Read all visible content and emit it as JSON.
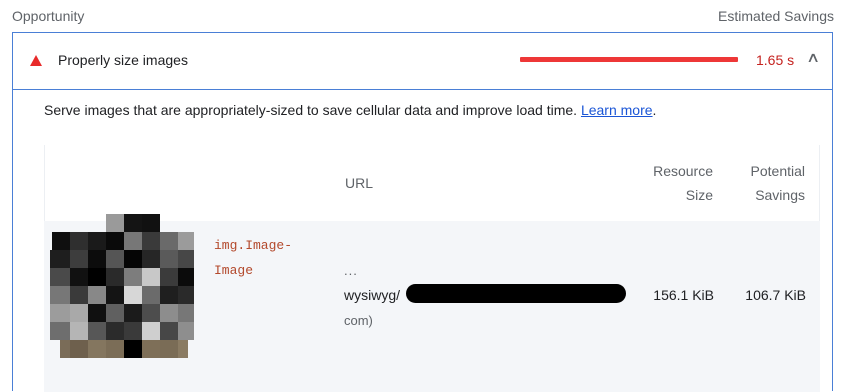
{
  "header": {
    "left": "Opportunity",
    "right": "Estimated Savings"
  },
  "audit": {
    "title": "Properly size images",
    "savings": "1.65 s",
    "description": "Serve images that are appropriately-sized to save cellular data and improve load time.",
    "learn_more": "Learn more",
    "colors": {
      "warning": "#e82a2a",
      "bar": "#ee3737",
      "link": "#1a55d6",
      "accent": "#4a7fd6"
    }
  },
  "table": {
    "columns": {
      "url": "URL",
      "resource_size_l1": "Resource",
      "resource_size_l2": "Size",
      "potential_savings_l1": "Potential",
      "potential_savings_l2": "Savings"
    },
    "rows": [
      {
        "node_line1": "img.Image-",
        "node_line2": "Image",
        "url_dots": "...",
        "url_prefix": "wysiwyg/",
        "url_host": "com)",
        "resource_size": "156.1 KiB",
        "potential_savings": "106.7 KiB"
      }
    ]
  }
}
